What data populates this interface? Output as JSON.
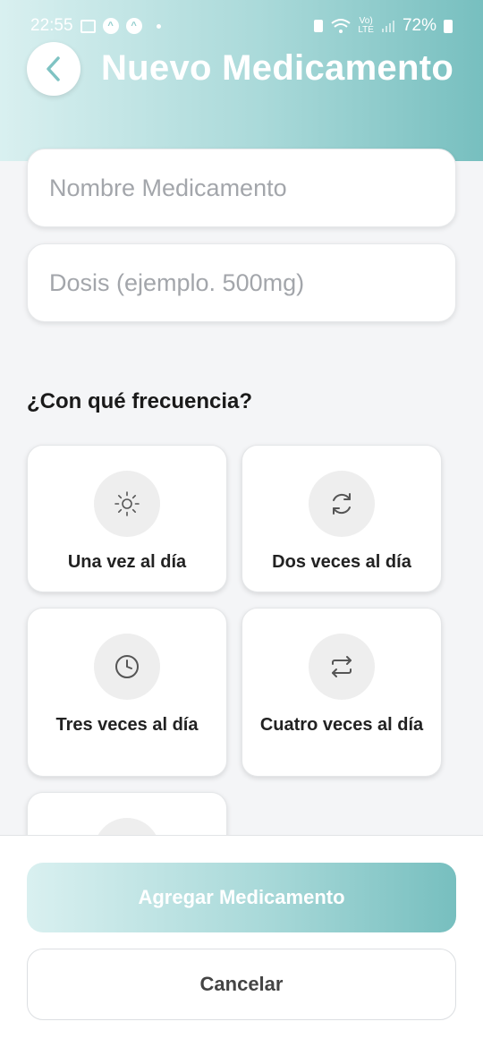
{
  "status_bar": {
    "time": "22:55",
    "network_top": "Vo)",
    "network_bottom": "LTE",
    "battery": "72%"
  },
  "header": {
    "title": "Nuevo Medicamento"
  },
  "form": {
    "name_placeholder": "Nombre Medicamento",
    "name_value": "",
    "dose_placeholder": "Dosis (ejemplo. 500mg)",
    "dose_value": ""
  },
  "frequency": {
    "label": "¿Con qué frecuencia?",
    "options": [
      {
        "label": "Una vez al día",
        "icon": "sun-icon"
      },
      {
        "label": "Dos veces al día",
        "icon": "refresh-icon"
      },
      {
        "label": "Tres veces al día",
        "icon": "clock-icon"
      },
      {
        "label": "Cuatro veces al día",
        "icon": "repeat-icon"
      },
      {
        "label": "",
        "icon": "unknown-icon"
      }
    ]
  },
  "actions": {
    "add_label": "Agregar Medicamento",
    "cancel_label": "Cancelar"
  },
  "colors": {
    "accent_light": "#d9f0f0",
    "accent_dark": "#77bfbf",
    "icon_color": "#555555"
  }
}
